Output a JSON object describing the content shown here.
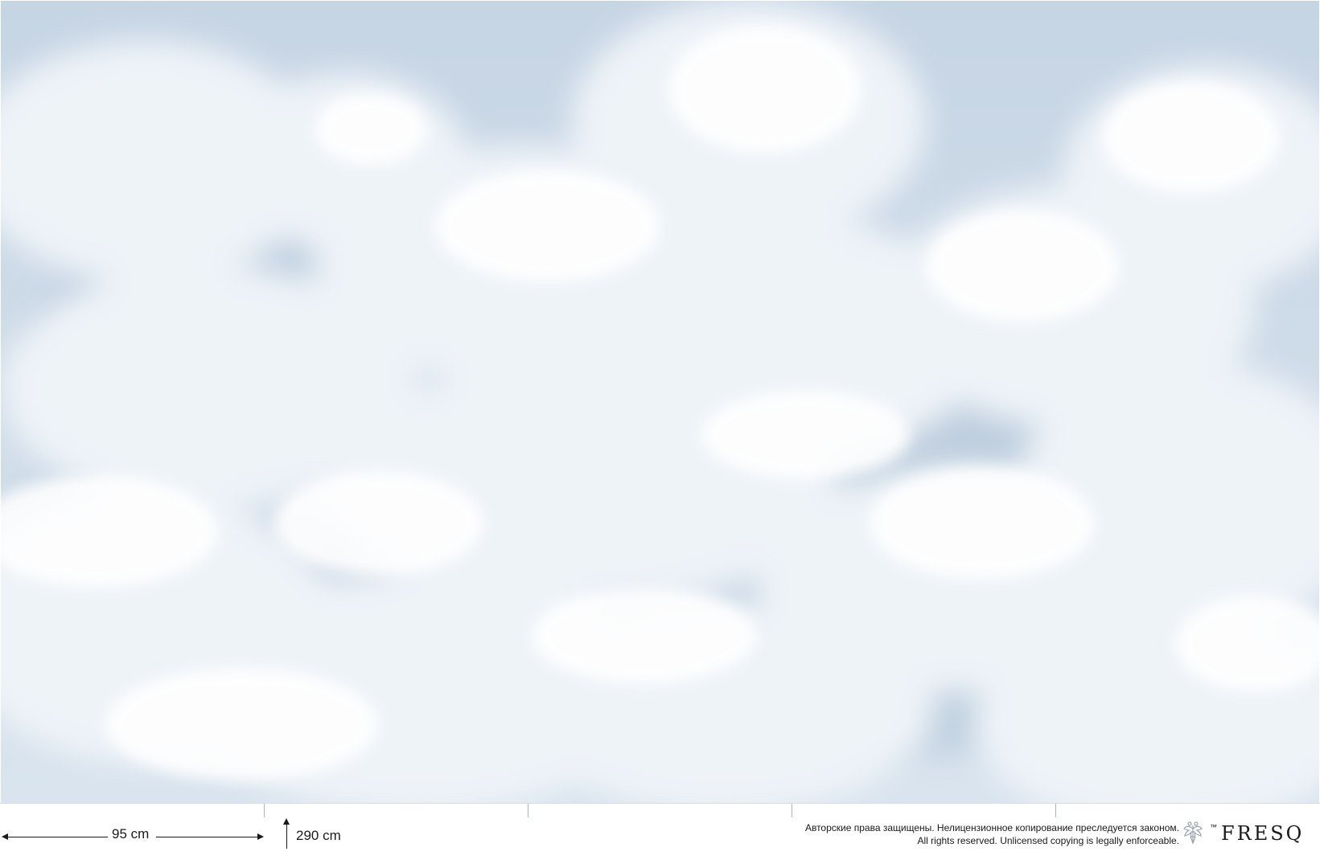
{
  "artwork": {
    "sky_color": "#c9d8e6",
    "cloud_color": "#f4f8fc",
    "shadow_color": "#b9cbdc"
  },
  "dimensions": {
    "panel_width": "95 cm",
    "height": "290 cm"
  },
  "copyright": {
    "line_ru": "Авторские права защищены. Нелицензионное копирование преследуется законом.",
    "line_en": "All rights reserved. Unlicensed copying is legally enforceable."
  },
  "brand": {
    "trademark": "™",
    "name": "FRESQ",
    "emblem_icon": "double-headed-eagle-icon"
  }
}
